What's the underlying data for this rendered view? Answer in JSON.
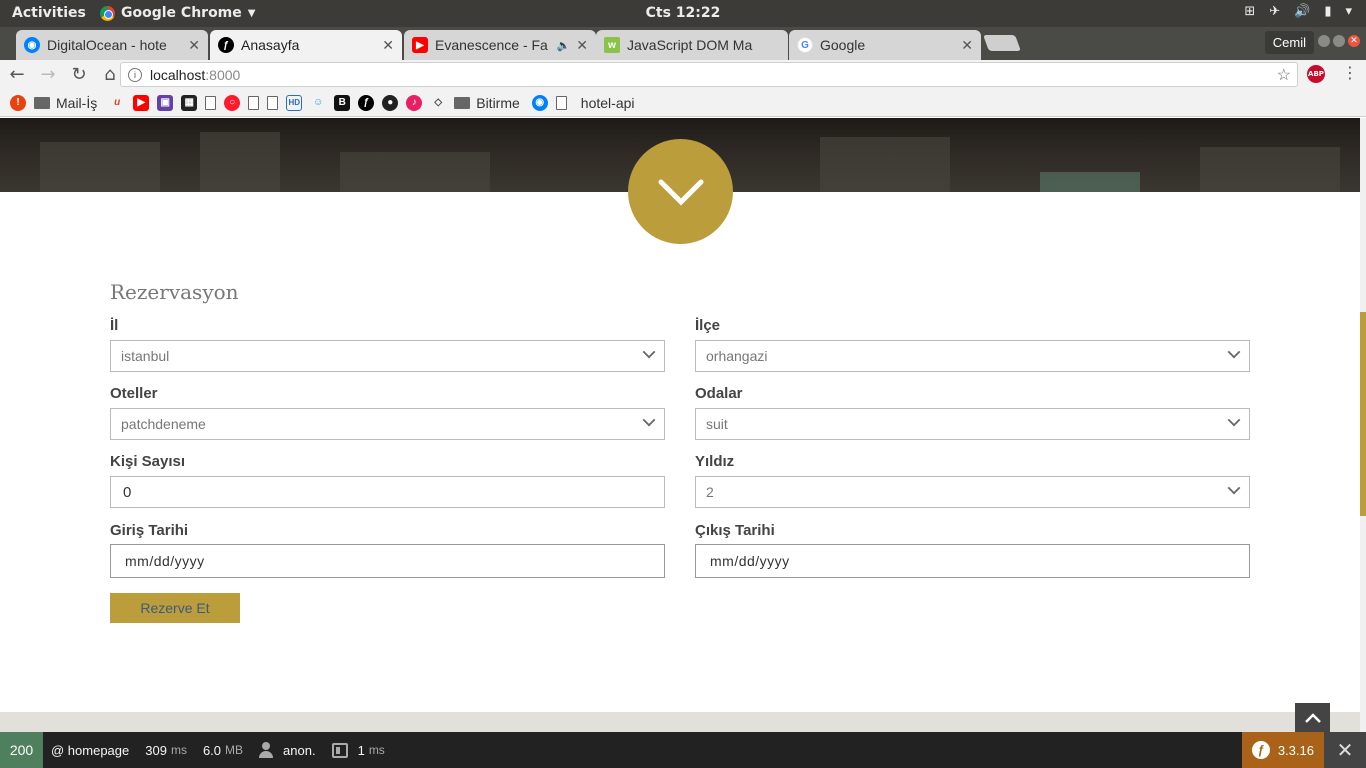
{
  "system": {
    "activities": "Activities",
    "app_name": "Google Chrome",
    "clock": "Cts 12:22"
  },
  "tabs": [
    {
      "title": "DigitalOcean - hote",
      "favicon": "digitalocean-icon",
      "color": "#0080ff"
    },
    {
      "title": "Anasayfa",
      "favicon": "symfony-icon",
      "color": "#000000"
    },
    {
      "title": "Evanescence - Fa",
      "favicon": "youtube-icon",
      "color": "#ff0000"
    },
    {
      "title": "JavaScript DOM Ma",
      "favicon": "w3-icon",
      "color": "#8bc34a"
    },
    {
      "title": "Google",
      "favicon": "google-icon",
      "color": "#4285f4"
    }
  ],
  "profile": "Cemil",
  "address": {
    "host": "localhost",
    "port": ":8000"
  },
  "bookmarks": {
    "mail": "Mail-İş",
    "bitirme": "Bitirme",
    "hotel_api": "hotel-api"
  },
  "form": {
    "title": "Rezervasyon",
    "il_label": "İl",
    "il_value": "istanbul",
    "ilce_label": "İlçe",
    "ilce_value": "orhangazi",
    "oteller_label": "Oteller",
    "oteller_value": "patchdeneme",
    "odalar_label": "Odalar",
    "odalar_value": "suit",
    "kisi_label": "Kişi Sayısı",
    "kisi_value": "0",
    "yildiz_label": "Yıldız",
    "yildiz_value": "2",
    "giris_label": "Giriş Tarihi",
    "giris_value": "mm/dd/yyyy",
    "cikis_label": "Çıkış Tarihi",
    "cikis_value": "mm/dd/yyyy",
    "submit": "Rezerve Et"
  },
  "colors": {
    "accent": "#bb9d3c",
    "status_ok": "#4f805d",
    "symfony": "#aa6218"
  },
  "debug": {
    "status": "200",
    "route": "@ homepage",
    "time_value": "309",
    "time_unit": "ms",
    "memory_value": "6.0",
    "memory_unit": "MB",
    "user": "anon.",
    "twig_value": "1",
    "twig_unit": "ms",
    "version": "3.3.16"
  }
}
